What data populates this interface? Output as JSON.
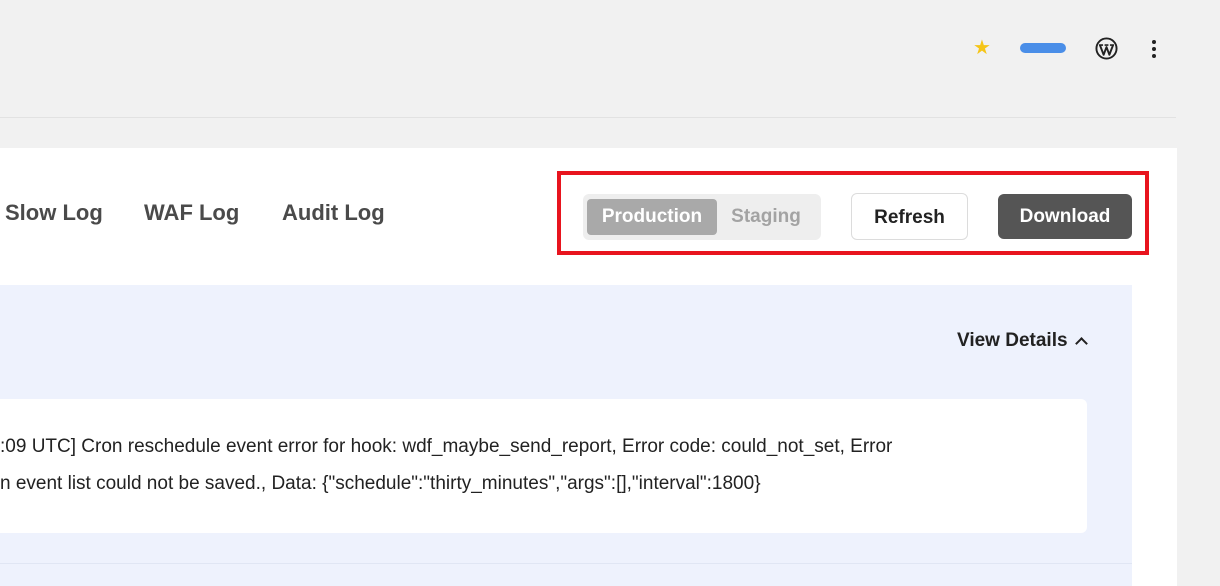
{
  "browser_bar": {
    "icons": [
      "star-icon",
      "wordpress-icon",
      "kebab-menu-icon"
    ],
    "colors": {
      "star": "#f5c518",
      "pill": "#4a8ee8"
    }
  },
  "tabs": [
    {
      "label": "Slow Log"
    },
    {
      "label": "WAF Log"
    },
    {
      "label": "Audit Log"
    }
  ],
  "environment": {
    "options": [
      "Production",
      "Staging"
    ],
    "selected": "Production"
  },
  "actions": {
    "refresh_label": "Refresh",
    "download_label": "Download"
  },
  "highlight_color": "#e8141e",
  "log": {
    "view_details_label": "View Details",
    "lines": [
      ":09 UTC] Cron reschedule event error for hook: wdf_maybe_send_report, Error code: could_not_set, Error",
      "n event list could not be saved., Data: {\"schedule\":\"thirty_minutes\",\"args\":[],\"interval\":1800}"
    ]
  }
}
